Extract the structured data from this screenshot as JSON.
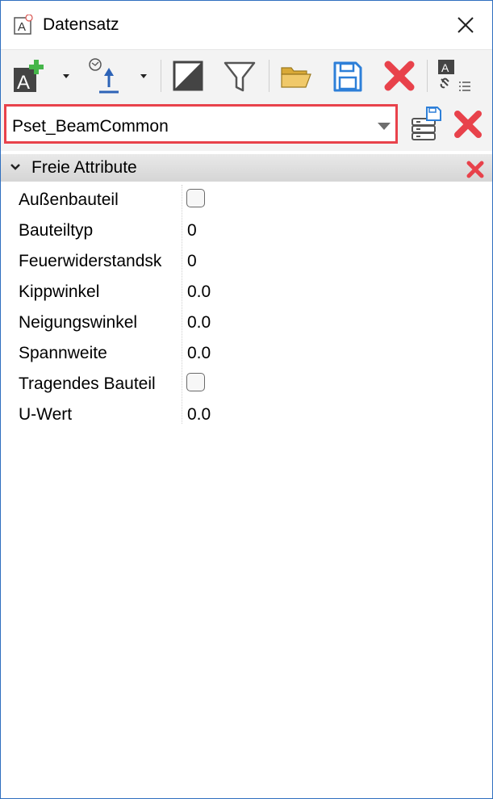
{
  "window": {
    "title": "Datensatz",
    "icon": "attribute-app-icon",
    "close_icon": "close-icon"
  },
  "toolbar": {
    "items": [
      {
        "name": "add-attribute-button",
        "icon": "add-attribute-icon",
        "has_dropdown": true
      },
      {
        "name": "import-button",
        "icon": "import-upload-icon",
        "has_dropdown": true
      },
      {
        "name": "contrast-button",
        "icon": "contrast-icon"
      },
      {
        "name": "filter-button",
        "icon": "filter-icon"
      },
      {
        "name": "open-button",
        "icon": "folder-open-icon"
      },
      {
        "name": "save-button",
        "icon": "save-icon"
      },
      {
        "name": "delete-button",
        "icon": "red-x-icon"
      },
      {
        "name": "link-attributes-button",
        "icon": "attribute-link-icon"
      }
    ]
  },
  "pset": {
    "selected": "Pset_BeamCommon",
    "save_icon": "database-save-icon",
    "delete_icon": "red-x-icon"
  },
  "section": {
    "title": "Freie Attribute",
    "expanded": true
  },
  "attributes": [
    {
      "label": "Außenbauteil",
      "type": "checkbox",
      "checked": false
    },
    {
      "label": "Bauteiltyp",
      "type": "text",
      "value": "0"
    },
    {
      "label": "Feuerwiderstandsk",
      "type": "text",
      "value": "0"
    },
    {
      "label": "Kippwinkel",
      "type": "text",
      "value": "0.0"
    },
    {
      "label": "Neigungswinkel",
      "type": "text",
      "value": "0.0"
    },
    {
      "label": "Spannweite",
      "type": "text",
      "value": "0.0"
    },
    {
      "label": "Tragendes Bauteil",
      "type": "checkbox",
      "checked": false
    },
    {
      "label": "U-Wert",
      "type": "text",
      "value": "0.0"
    }
  ],
  "colors": {
    "accent_red": "#e8424b",
    "window_border": "#2f6fbf",
    "save_blue": "#2d7fd8",
    "folder_yellow": "#e8b84a"
  }
}
